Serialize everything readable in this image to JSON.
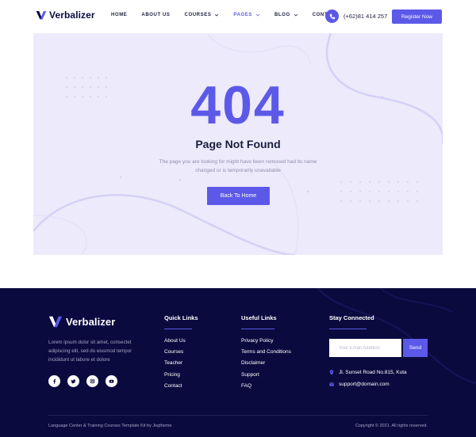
{
  "brand": {
    "name": "Verbalizer",
    "accent": "#5c59e8",
    "dark": "#0b0a3f"
  },
  "nav": {
    "items": [
      {
        "label": "HOME",
        "has_dropdown": false,
        "active": false
      },
      {
        "label": "ABOUT US",
        "has_dropdown": false,
        "active": false
      },
      {
        "label": "COURSES",
        "has_dropdown": true,
        "active": false
      },
      {
        "label": "PAGES",
        "has_dropdown": true,
        "active": true
      },
      {
        "label": "BLOG",
        "has_dropdown": true,
        "active": false
      },
      {
        "label": "CONTACT",
        "has_dropdown": false,
        "active": false
      }
    ],
    "phone": "(+62)81 414 257",
    "register_label": "Register Now"
  },
  "error": {
    "code": "404",
    "title": "Page Not Found",
    "description": "The page you are looking for might have been removed had its name changed or is temporarily unavailable",
    "button_label": "Back To Home"
  },
  "footer": {
    "about": "Lorem ipsum dolor sit amet, consectet adipiscing elit, sed do eiusmod tempor incididunt ut labore et dolore",
    "socials": [
      "facebook-icon",
      "twitter-icon",
      "instagram-icon",
      "youtube-icon"
    ],
    "quick_links": {
      "title": "Quick Links",
      "items": [
        "About Us",
        "Courses",
        "Teacher",
        "Pricing",
        "Contact"
      ]
    },
    "useful_links": {
      "title": "Useful Links",
      "items": [
        "Privacy Policy",
        "Terms and Conditions",
        "Disclaimer",
        "Support",
        "FAQ"
      ]
    },
    "stay_connected": {
      "title": "Stay Connected",
      "email_placeholder": "Your Email Address",
      "send_label": "Send",
      "address": "Jl. Sunset Road No.815, Kuta",
      "email": "support@domain.com"
    },
    "bottom_left": "Language Center & Training Courses Template Kit by Jegtheme",
    "bottom_right": "Copyright © 2021. All rights reserved."
  }
}
